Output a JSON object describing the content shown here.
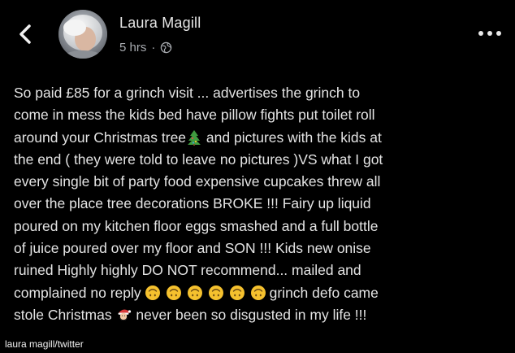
{
  "header": {
    "author_name": "Laura Magill",
    "timestamp": "5 hrs",
    "separator": "·",
    "privacy_icon": "globe-icon",
    "back_icon": "chevron-left-icon",
    "more_icon": "more-horizontal-icon"
  },
  "post": {
    "lines": [
      "So paid £85 for a grinch visit ... advertises the grinch to",
      "come in mess the kids bed have pillow fights put toilet roll",
      "around your Christmas tree",
      "and pictures with the kids at",
      "the end ( they were told to leave no pictures )VS what I got",
      "every single bit of party food expensive cupcakes threw all",
      "over the place tree decorations BROKE !!! Fairy up liquid",
      "poured on my kitchen floor eggs smashed and a full bottle",
      "of juice poured over my floor and SON !!! Kids new onise",
      "ruined Highly highly DO NOT recommend... mailed and",
      "complained no reply",
      "grinch defo came",
      "stole Christmas",
      "never been so disgusted in my life !!!"
    ],
    "emojis": {
      "tree": "christmas-tree-icon",
      "upside_down_count": 6,
      "upside_down": "upside-down-face-icon",
      "santa": "santa-icon"
    }
  },
  "credit": "laura magill/twitter",
  "colors": {
    "background": "#000000",
    "text": "#e4e4e4",
    "meta": "#a8abb0"
  }
}
